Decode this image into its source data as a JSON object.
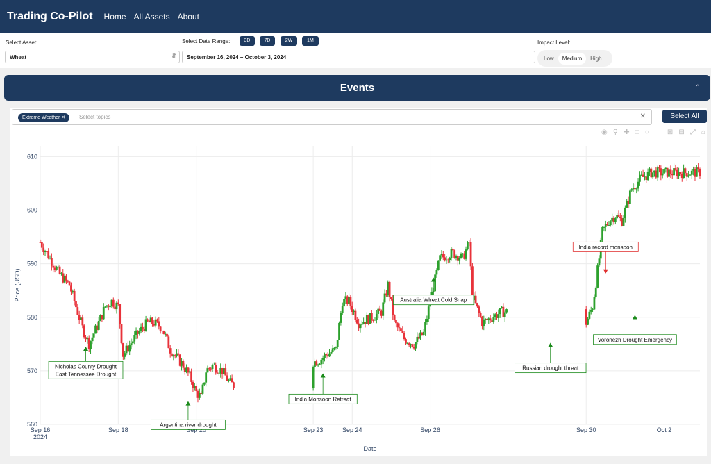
{
  "nav": {
    "brand": "Trading Co-Pilot",
    "links": [
      "Home",
      "All Assets",
      "About"
    ]
  },
  "controls": {
    "asset_label": "Select Asset:",
    "asset_value": "Wheat",
    "range_label": "Select Date Range:",
    "range_buttons": [
      "3D",
      "7D",
      "2W",
      "1M"
    ],
    "date_value": "September 16, 2024 – October 3, 2024",
    "impact_label": "Impact Level:",
    "impact_options": [
      "Low",
      "Medium",
      "High"
    ],
    "impact_selected": "Medium"
  },
  "events_panel": {
    "title": "Events",
    "topic_chip": "Extreme Weather",
    "topics_placeholder": "Select topics",
    "select_all_label": "Select All"
  },
  "modebar_icons": [
    "camera-icon",
    "zoom-icon",
    "pan-icon",
    "box-select-icon",
    "lasso-icon",
    "zoom-in-icon",
    "zoom-out-icon",
    "autoscale-icon",
    "reset-axes-icon"
  ],
  "colors": {
    "up": "#2ca02c",
    "down": "#e8323a",
    "navy": "#1e3a5f",
    "up_annot": "#1a8a1a",
    "down_annot": "#e03030"
  },
  "chart_data": {
    "type": "candlestick",
    "xlabel": "Date",
    "ylabel": "Price (USD)",
    "ylim": [
      560,
      612
    ],
    "xlim": [
      "2024-09-16",
      "2024-10-02T22:00"
    ],
    "yticks": [
      560,
      570,
      580,
      590,
      600,
      610
    ],
    "xticks": [
      {
        "date": "2024-09-16",
        "label": "Sep 16",
        "sub": "2024"
      },
      {
        "date": "2024-09-18",
        "label": "Sep 18"
      },
      {
        "date": "2024-09-20",
        "label": "Sep 20"
      },
      {
        "date": "2024-09-23",
        "label": "Sep 23"
      },
      {
        "date": "2024-09-24",
        "label": "Sep 24"
      },
      {
        "date": "2024-09-26",
        "label": "Sep 26"
      },
      {
        "date": "2024-09-30",
        "label": "Sep 30"
      },
      {
        "date": "2024-10-02",
        "label": "Oct 2"
      }
    ],
    "grid": true,
    "price_path": [
      [
        "2024-09-16T00:00",
        594
      ],
      [
        "2024-09-16T12:00",
        588
      ],
      [
        "2024-09-16T18:00",
        586
      ],
      [
        "2024-09-17T02:00",
        578
      ],
      [
        "2024-09-17T06:00",
        575
      ],
      [
        "2024-09-17T12:00",
        579
      ],
      [
        "2024-09-17T16:00",
        582
      ],
      [
        "2024-09-17T20:00",
        583
      ],
      [
        "2024-09-18T00:00",
        582
      ],
      [
        "2024-09-18T03:00",
        573
      ],
      [
        "2024-09-18T12:00",
        577
      ],
      [
        "2024-09-18T18:00",
        579
      ],
      [
        "2024-09-18T22:00",
        579
      ],
      [
        "2024-09-19T03:00",
        578
      ],
      [
        "2024-09-19T08:00",
        574
      ],
      [
        "2024-09-19T16:00",
        571
      ],
      [
        "2024-09-19T20:00",
        569
      ],
      [
        "2024-09-20T00:00",
        566
      ],
      [
        "2024-09-20T03:00",
        565
      ],
      [
        "2024-09-20T06:00",
        570
      ],
      [
        "2024-09-20T10:00",
        571
      ],
      [
        "2024-09-20T16:00",
        570
      ],
      [
        "2024-09-20T20:00",
        568
      ],
      [
        "2024-09-21T00:00",
        567
      ],
      [
        "2024-09-23T04:00",
        572
      ],
      [
        "2024-09-23T08:00",
        573
      ],
      [
        "2024-09-23T14:00",
        574
      ],
      [
        "2024-09-23T18:00",
        583
      ],
      [
        "2024-09-23T22:00",
        583
      ],
      [
        "2024-09-24T04:00",
        579
      ],
      [
        "2024-09-24T12:00",
        580
      ],
      [
        "2024-09-24T18:00",
        581
      ],
      [
        "2024-09-24T22:00",
        586
      ],
      [
        "2024-09-25T02:00",
        579
      ],
      [
        "2024-09-25T08:00",
        576
      ],
      [
        "2024-09-25T14:00",
        575
      ],
      [
        "2024-09-25T20:00",
        577
      ],
      [
        "2024-09-26T00:00",
        583
      ],
      [
        "2024-09-26T06:00",
        591
      ],
      [
        "2024-09-26T14:00",
        592
      ],
      [
        "2024-09-26T20:00",
        591
      ],
      [
        "2024-09-27T00:00",
        594
      ],
      [
        "2024-09-27T02:00",
        584
      ],
      [
        "2024-09-27T08:00",
        579
      ],
      [
        "2024-09-27T14:00",
        580
      ],
      [
        "2024-09-27T20:00",
        581
      ],
      [
        "2024-09-28T00:00",
        581
      ],
      [
        "2024-09-28T04:00",
        578
      ],
      [
        "2024-09-28T10:00",
        580
      ],
      [
        "2024-09-28T16:00",
        577
      ],
      [
        "2024-09-28T20:00",
        577
      ],
      [
        "2024-09-29T00:00",
        579
      ],
      [
        "2024-09-29T04:00",
        582
      ],
      [
        "2024-09-29T08:00",
        584
      ],
      [
        "2024-09-29T12:00",
        586
      ],
      [
        "2024-09-29T16:00",
        584
      ],
      [
        "2024-09-29T20:00",
        580
      ],
      [
        "2024-09-30T00:00",
        579
      ],
      [
        "2024-09-30T04:00",
        582
      ],
      [
        "2024-09-30T08:00",
        591
      ],
      [
        "2024-09-30T10:00",
        596
      ],
      [
        "2024-09-30T14:00",
        598
      ],
      [
        "2024-09-30T18:00",
        599
      ],
      [
        "2024-09-30T22:00",
        598
      ],
      [
        "2024-10-01T04:00",
        604
      ],
      [
        "2024-10-01T10:00",
        606
      ],
      [
        "2024-10-01T16:00",
        607
      ],
      [
        "2024-10-02T22:00",
        607
      ]
    ],
    "annotations": [
      {
        "text": [
          "Nicholas County Drought",
          "East Tennessee Drought"
        ],
        "x": "2024-09-17T04:00",
        "y": 574.4,
        "label_y": 571.5,
        "kind": "up"
      },
      {
        "text": [
          "Argentina river drought"
        ],
        "x": "2024-09-19T19:00",
        "y": 564.2,
        "label_y": 560.6,
        "kind": "up"
      },
      {
        "text": [
          "India Monsoon Retreat"
        ],
        "x": "2024-09-23T06:00",
        "y": 569.4,
        "label_y": 565.4,
        "kind": "up"
      },
      {
        "text": [
          "Australia Wheat Cold Snap"
        ],
        "x": "2024-09-26T02:00",
        "y": 587.3,
        "label_y": 583.9,
        "kind": "up"
      },
      {
        "text": [
          "Russian drought threat"
        ],
        "x": "2024-09-29T02:00",
        "y": 575.1,
        "label_y": 571.2,
        "kind": "up"
      },
      {
        "text": [
          "India record monsoon"
        ],
        "x": "2024-09-30T12:00",
        "y": 588.3,
        "label_y": 592.5,
        "kind": "down"
      },
      {
        "text": [
          "Voronezh Drought Emergency"
        ],
        "x": "2024-10-01T06:00",
        "y": 580.3,
        "label_y": 576.5,
        "kind": "up"
      }
    ]
  }
}
